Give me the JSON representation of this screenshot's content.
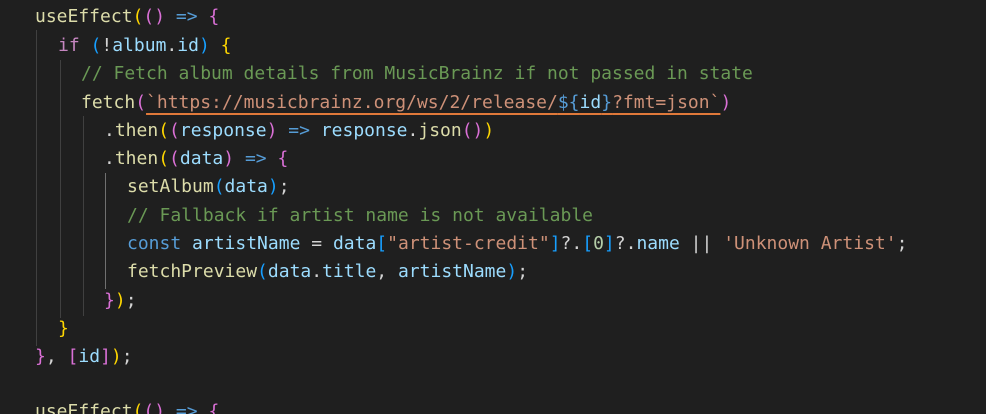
{
  "code": {
    "l1": {
      "fn": "useEffect",
      "open": "(",
      "params": "()",
      "arrow": "=>",
      "brace": "{"
    },
    "l2": {
      "kw": "if",
      "open": "(",
      "not": "!",
      "obj": "album",
      "dot": ".",
      "prop": "id",
      "close": ")",
      "brace": "{"
    },
    "l3": {
      "comment": "// Fetch album details from MusicBrainz if not passed in state"
    },
    "l4": {
      "fn": "fetch",
      "open": "(",
      "tpl_start": "`https://musicbrainz.org/ws/2/release/",
      "interp_open": "${",
      "interp_var": "id",
      "interp_close": "}",
      "tpl_end": "?fmt=json`",
      "close": ")"
    },
    "l5": {
      "dot": ".",
      "fn": "then",
      "open": "(",
      "popen": "(",
      "param": "response",
      "pclose": ")",
      "arrow": "=>",
      "obj": "response",
      "dot2": ".",
      "fn2": "json",
      "call": "()",
      "close": ")"
    },
    "l6": {
      "dot": ".",
      "fn": "then",
      "open": "(",
      "popen": "(",
      "param": "data",
      "pclose": ")",
      "arrow": "=>",
      "brace": "{"
    },
    "l7": {
      "fn": "setAlbum",
      "open": "(",
      "arg": "data",
      "close": ")",
      "semi": ";"
    },
    "l8": {
      "comment": "// Fallback if artist name is not available"
    },
    "l9": {
      "kw": "const",
      "var": "artistName",
      "eq": "=",
      "obj": "data",
      "bopen": "[",
      "str": "\"artist-credit\"",
      "bclose": "]",
      "opt": "?.",
      "iopen": "[",
      "num": "0",
      "iclose": "]",
      "opt2": "?.",
      "prop": "name",
      "or": "||",
      "str2": "'Unknown Artist'",
      "semi": ";"
    },
    "l10": {
      "fn": "fetchPreview",
      "open": "(",
      "obj": "data",
      "dot": ".",
      "prop": "title",
      "comma": ",",
      "arg2": "artistName",
      "close": ")",
      "semi": ";"
    },
    "l11": {
      "brace": "}",
      "close": ")",
      "semi": ";"
    },
    "l12": {
      "brace": "}"
    },
    "l13": {
      "brace": "}",
      "comma": ",",
      "aopen": "[",
      "dep": "id",
      "aclose": "]",
      "close": ")",
      "semi": ";"
    },
    "l14": {
      "fn": "useEffect",
      "open": "(",
      "params": "()",
      "arrow": "=>",
      "brace": "{"
    }
  }
}
